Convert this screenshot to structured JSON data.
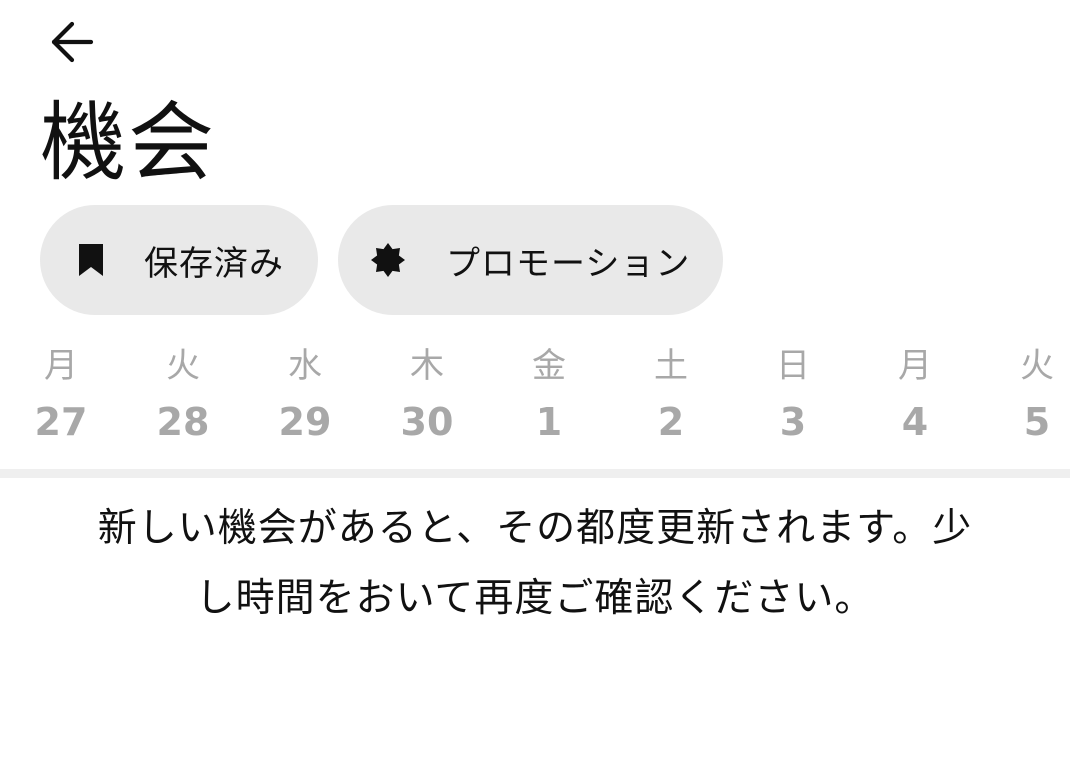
{
  "header": {
    "back_icon": "arrow-left-icon",
    "title": "機会"
  },
  "filters": {
    "saved": {
      "label": "保存済み",
      "icon": "bookmark-icon"
    },
    "promotion": {
      "label": "プロモーション",
      "icon": "badge-icon"
    }
  },
  "dates": [
    {
      "weekday": "月",
      "day": "27"
    },
    {
      "weekday": "火",
      "day": "28"
    },
    {
      "weekday": "水",
      "day": "29"
    },
    {
      "weekday": "木",
      "day": "30"
    },
    {
      "weekday": "金",
      "day": "1"
    },
    {
      "weekday": "土",
      "day": "2"
    },
    {
      "weekday": "日",
      "day": "3"
    },
    {
      "weekday": "月",
      "day": "4"
    },
    {
      "weekday": "火",
      "day": "5"
    }
  ],
  "empty_state": {
    "message": "新しい機会があると、その都度更新されます。少し時間をおいて再度ご確認ください。"
  },
  "colors": {
    "chip_background": "#e9e9e9",
    "muted_text": "#a8a8a8",
    "divider": "#efefef",
    "text": "#111111"
  }
}
